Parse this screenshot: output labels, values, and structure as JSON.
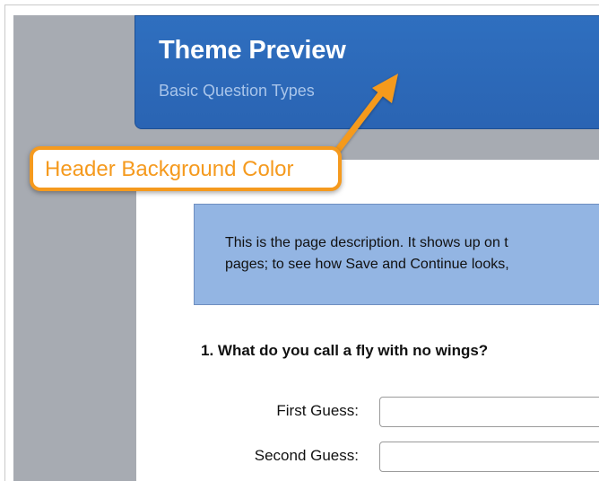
{
  "header": {
    "title": "Theme Preview",
    "subtitle": "Basic Question Types"
  },
  "description": {
    "line1": "This is the page description. It shows up on t",
    "line2": "pages; to see how Save and Continue looks,"
  },
  "question": {
    "text": "1. What do you call a fly with no wings?",
    "fields": [
      {
        "label": "First Guess:",
        "value": ""
      },
      {
        "label": "Second Guess:",
        "value": ""
      }
    ]
  },
  "callout": {
    "text": "Header Background Color"
  },
  "colors": {
    "header_background": "#2f6fbf",
    "callout_accent": "#f59a1e",
    "description_background": "#93b5e3",
    "page_background": "#a7abb2"
  }
}
